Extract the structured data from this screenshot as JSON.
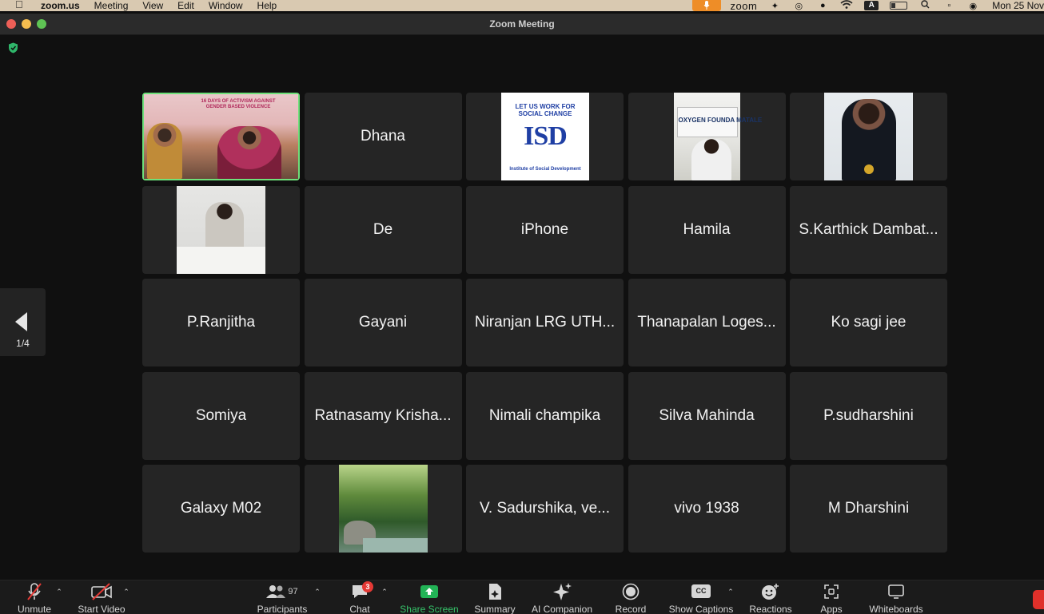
{
  "menubar": {
    "app_name": "zoom.us",
    "menus": [
      "Meeting",
      "View",
      "Edit",
      "Window",
      "Help"
    ],
    "zoom_label": "zoom",
    "input_indicator": "A",
    "clock": "Mon 25 Nov"
  },
  "window": {
    "title": "Zoom Meeting"
  },
  "pager": {
    "label": "1/4"
  },
  "banner_text": "16 DAYS OF ACTIVISM AGAINST GENDER BASED VIOLENCE",
  "isd_logo": {
    "arc_text": "LET US WORK FOR SOCIAL CHANGE",
    "letters": "ISD",
    "caption": "Institute of Social Development"
  },
  "office_sign_text": "OXYGEN FOUNDA MATALE",
  "participants": [
    {
      "name": "",
      "kind": "video-banner"
    },
    {
      "name": "Dhana",
      "kind": "name"
    },
    {
      "name": "",
      "kind": "video-isd"
    },
    {
      "name": "",
      "kind": "video-office"
    },
    {
      "name": "",
      "kind": "video-medal"
    },
    {
      "name": "",
      "kind": "video-writer"
    },
    {
      "name": "De",
      "kind": "name"
    },
    {
      "name": "iPhone",
      "kind": "name"
    },
    {
      "name": "Hamila",
      "kind": "name"
    },
    {
      "name": "S.Karthick Dambat...",
      "kind": "name"
    },
    {
      "name": "P.Ranjitha",
      "kind": "name"
    },
    {
      "name": "Gayani",
      "kind": "name"
    },
    {
      "name": "Niranjan LRG UTH...",
      "kind": "name"
    },
    {
      "name": "Thanapalan Loges...",
      "kind": "name"
    },
    {
      "name": "Ko sagi jee",
      "kind": "name"
    },
    {
      "name": "Somiya",
      "kind": "name"
    },
    {
      "name": "Ratnasamy Krisha...",
      "kind": "name"
    },
    {
      "name": "Nimali champika",
      "kind": "name"
    },
    {
      "name": "Silva Mahinda",
      "kind": "name"
    },
    {
      "name": "P.sudharshini",
      "kind": "name"
    },
    {
      "name": "Galaxy M02",
      "kind": "name"
    },
    {
      "name": "",
      "kind": "video-forest"
    },
    {
      "name": "V. Sadurshika,   ve...",
      "kind": "name"
    },
    {
      "name": "vivo 1938",
      "kind": "name"
    },
    {
      "name": "M Dharshini",
      "kind": "name"
    }
  ],
  "toolbar": {
    "unmute": "Unmute",
    "start_video": "Start Video",
    "participants": "Participants",
    "participants_count": "97",
    "chat": "Chat",
    "chat_badge": "3",
    "share_screen": "Share Screen",
    "summary": "Summary",
    "ai_companion": "AI Companion",
    "record": "Record",
    "show_captions": "Show Captions",
    "captions_icon_text": "CC",
    "reactions": "Reactions",
    "apps": "Apps",
    "whiteboards": "Whiteboards"
  },
  "colors": {
    "active_speaker": "#6ee07a",
    "share_green": "#22b356",
    "badge_red": "#e53935",
    "mic_pill": "#ee8d27"
  }
}
